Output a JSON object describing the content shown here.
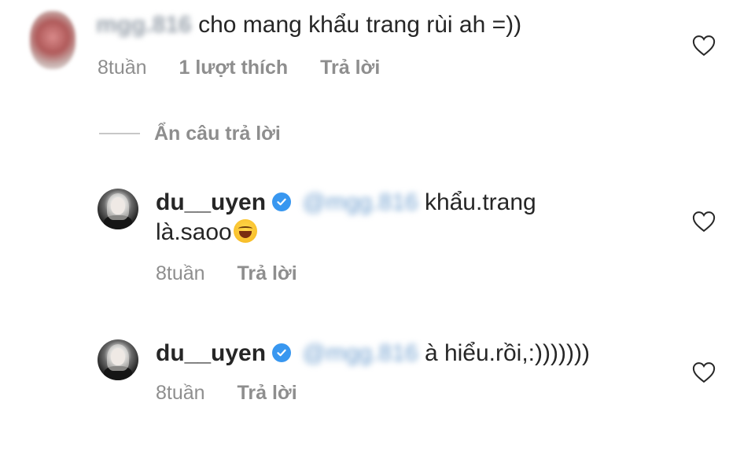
{
  "top_comment": {
    "username": "mgg.816",
    "text": "cho mang khẩu trang rùi ah =))",
    "time": "8tuần",
    "likes": "1 lượt thích",
    "reply": "Trả lời"
  },
  "hide_replies": "Ẩn câu trả lời",
  "replies": [
    {
      "username": "du__uyen",
      "mention": "@mgg.816",
      "text_line1": "khẩu.trang",
      "text_line2": "là.saoo",
      "emoji": "face-with-tears-of-joy",
      "time": "8tuần",
      "reply": "Trả lời"
    },
    {
      "username": "du__uyen",
      "mention": "@mgg.816",
      "text_line1": "à hiểu.rồi,:)))))))",
      "time": "8tuần",
      "reply": "Trả lời"
    }
  ],
  "colors": {
    "text": "#262626",
    "muted": "#8e8e8e",
    "verified": "#3897f0",
    "mention": "#6f9fcf"
  }
}
